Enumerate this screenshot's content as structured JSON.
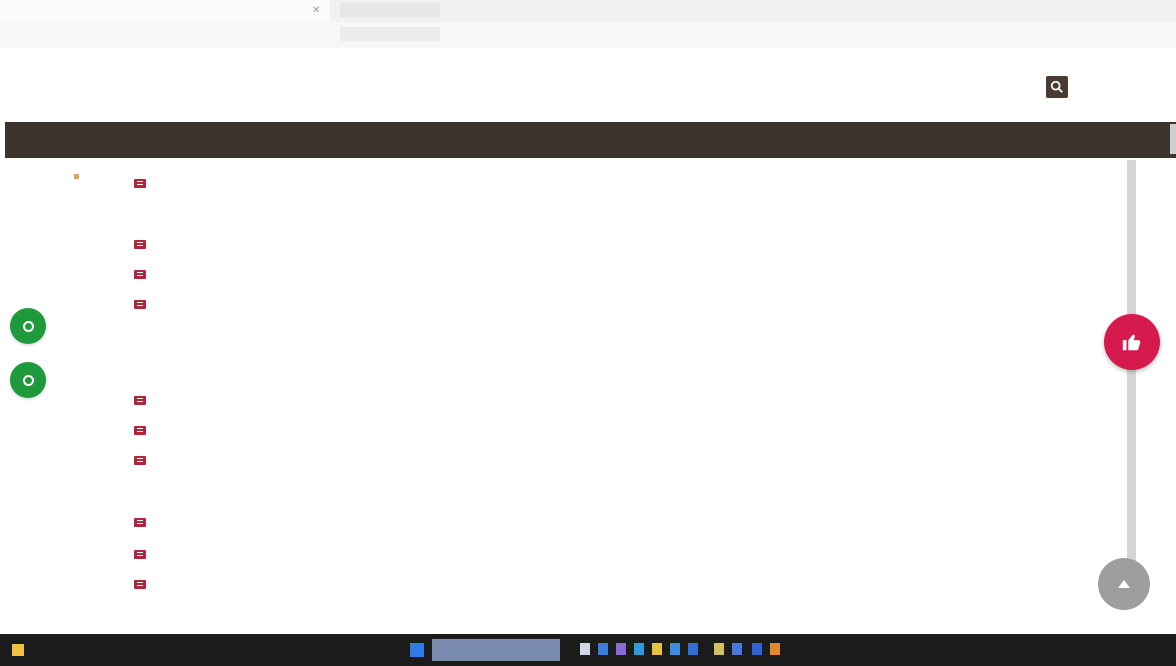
{
  "browser": {
    "tab_title": "",
    "url": "",
    "window_controls": "",
    "nav_buttons": "",
    "extensions": ""
  },
  "header": {
    "nav_links": [
      "",
      "",
      "",
      ""
    ]
  },
  "main_menu": {
    "items": [
      "",
      "",
      ""
    ]
  },
  "content": {
    "groups": [
      "",
      "",
      "",
      ""
    ],
    "top_level_item": "",
    "links": [
      "",
      "",
      "",
      "",
      "",
      "",
      "",
      "",
      "",
      ""
    ]
  },
  "colors": {
    "menu_bar": "#3d342e",
    "link": "#c0485e",
    "list_icon": "#b3253a",
    "fab_green": "#1e9a3c",
    "fab_red": "#d61a4e",
    "fab_grey": "#9e9e9e",
    "taskbar": "#1b1b1b"
  },
  "icons": {
    "search": "search-icon",
    "list_item": "doc-icon",
    "fab_green": "circle-icon",
    "fab_red": "like-icon",
    "fab_grey": "arrow-up-icon"
  },
  "taskbar": {
    "start_label": "",
    "tray": ""
  }
}
